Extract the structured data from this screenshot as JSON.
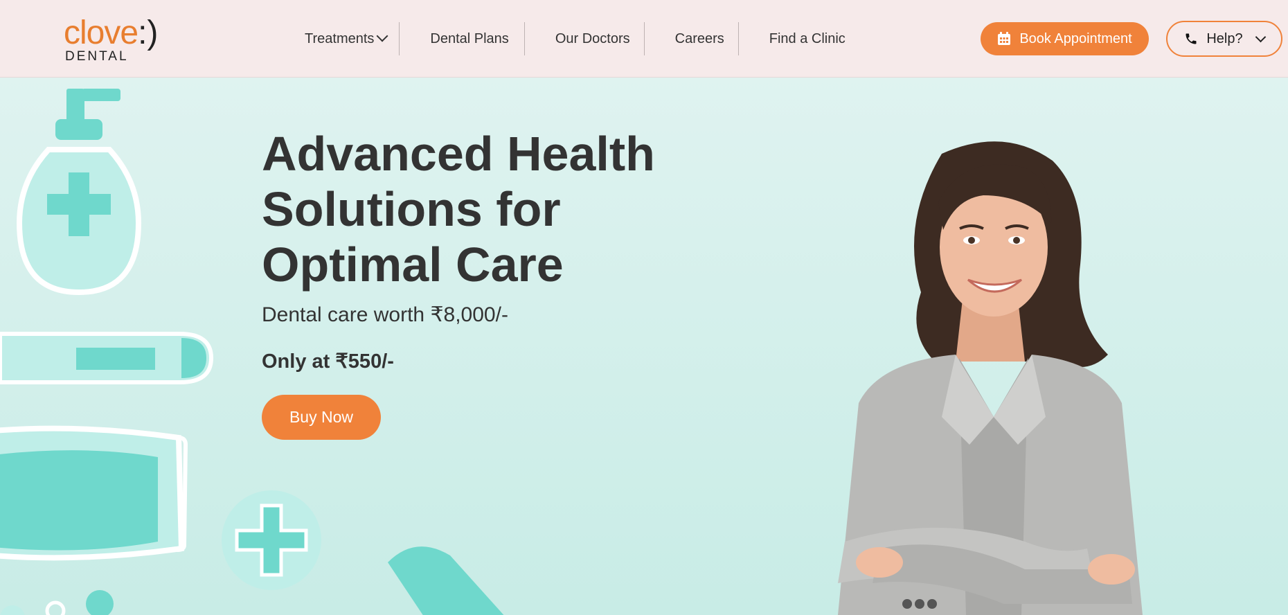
{
  "brand": {
    "name": "clove",
    "smile": ":)",
    "sub": "DENTAL"
  },
  "nav": {
    "items": [
      {
        "label": "Treatments"
      },
      {
        "label": "Dental Plans"
      },
      {
        "label": "Our Doctors"
      },
      {
        "label": "Careers"
      },
      {
        "label": "Find a Clinic"
      }
    ]
  },
  "actions": {
    "book_label": "Book Appointment",
    "help_label": "Help?"
  },
  "hero": {
    "title": "Advanced Health Solutions for Optimal Care",
    "subtitle": "Dental care worth ₹8,000/-",
    "price": "Only at ₹550/-",
    "cta": "Buy Now"
  },
  "colors": {
    "accent": "#f0823a",
    "header_bg": "#f6eaea",
    "hero_bg": "#dff3f0",
    "teal": "#6fd8cc"
  },
  "icons": [
    "calendar-icon",
    "phone-icon",
    "chevron-down-icon"
  ]
}
